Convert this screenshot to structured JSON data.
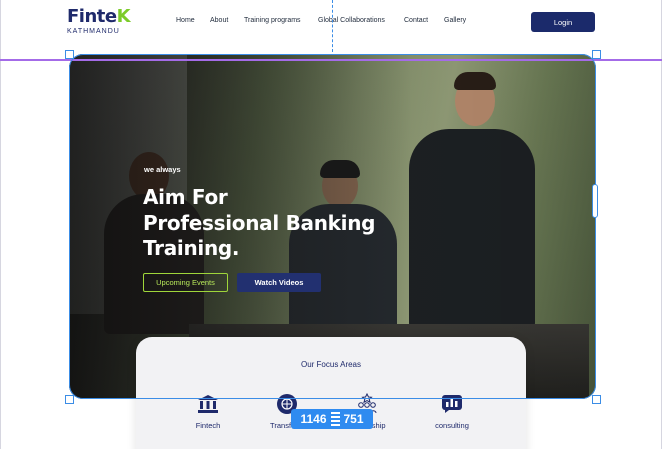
{
  "header": {
    "logo_main": "Finte",
    "logo_accent": "K",
    "logo_sub": "KATHMANDU",
    "nav": [
      "Home",
      "About",
      "Training programs",
      "Global Collaborations",
      "Contact",
      "Gallery"
    ],
    "login_label": "Login"
  },
  "hero": {
    "eyebrow": "we always",
    "headline_line1": "Aim For",
    "headline_line2": "Professional Banking",
    "headline_line3": "Training.",
    "btn_events": "Upcoming Events",
    "btn_videos": "Watch Videos"
  },
  "focus": {
    "title": "Our Focus Areas",
    "items": [
      {
        "label": "Fintech",
        "icon": "bank-icon"
      },
      {
        "label": "Transform",
        "icon": "transformation-icon"
      },
      {
        "label": "Leadership",
        "icon": "leadership-icon"
      },
      {
        "label": "consulting",
        "icon": "consulting-icon"
      }
    ]
  },
  "editor": {
    "width_value": "1146",
    "height_value": "751"
  },
  "colors": {
    "brand_navy": "#1b2a6b",
    "brand_green": "#7ccb2a",
    "selection_blue": "#3b8de6",
    "guide_purple": "#a46be8"
  }
}
